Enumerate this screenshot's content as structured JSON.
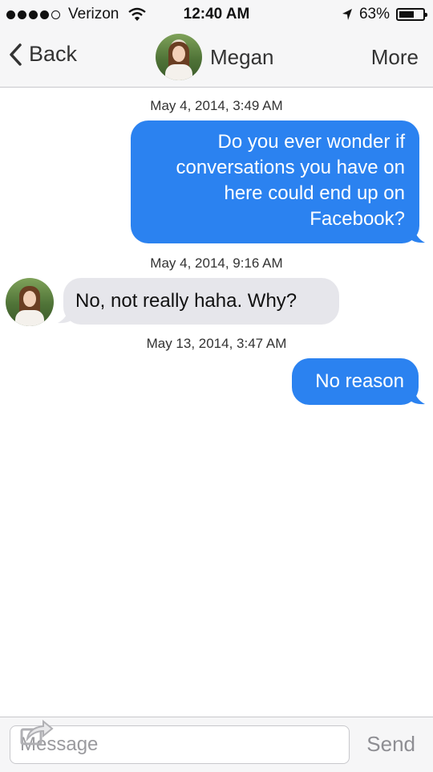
{
  "status_bar": {
    "carrier": "Verizon",
    "signal_bars_filled": 4,
    "signal_bars_total": 5,
    "time": "12:40 AM",
    "battery_percent_label": "63%",
    "battery_level": 0.63
  },
  "nav": {
    "back_label": "Back",
    "title": "Megan",
    "more_label": "More"
  },
  "messages": [
    {
      "timestamp": "May 4, 2014, 3:49 AM",
      "direction": "outgoing",
      "lines": [
        "Do you ever wonder if",
        "conversations you have on",
        "here could end up on",
        "Facebook?"
      ]
    },
    {
      "timestamp": "May 4, 2014, 9:16 AM",
      "direction": "incoming",
      "text": "No, not really haha. Why?"
    },
    {
      "timestamp": "May 13, 2014, 3:47 AM",
      "direction": "outgoing",
      "text": "No reason"
    }
  ],
  "composer": {
    "placeholder": "Message",
    "send_label": "Send"
  },
  "colors": {
    "outgoing_bubble": "#2b82f0",
    "incoming_bubble": "#e6e6eb",
    "bars_background": "#f6f6f7"
  },
  "icons": {
    "back": "chevron-left-icon",
    "wifi": "wifi-icon",
    "location": "location-arrow-icon",
    "battery": "battery-icon",
    "attach": "share-attach-icon"
  }
}
